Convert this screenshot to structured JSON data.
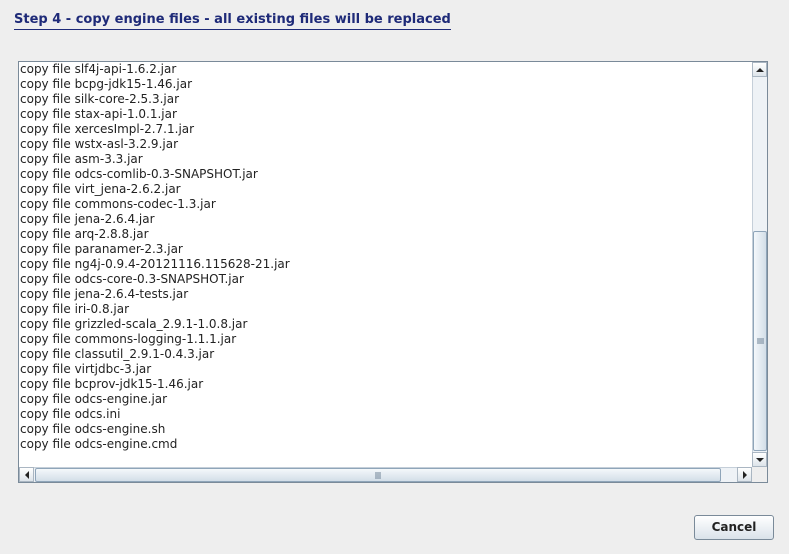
{
  "header": {
    "title": "Step 4 - copy engine files - all existing files will be replaced"
  },
  "log": {
    "lines": [
      "copy file slf4j-api-1.6.2.jar",
      "copy file bcpg-jdk15-1.46.jar",
      "copy file silk-core-2.5.3.jar",
      "copy file stax-api-1.0.1.jar",
      "copy file xercesImpl-2.7.1.jar",
      "copy file wstx-asl-3.2.9.jar",
      "copy file asm-3.3.jar",
      "copy file odcs-comlib-0.3-SNAPSHOT.jar",
      "copy file virt_jena-2.6.2.jar",
      "copy file commons-codec-1.3.jar",
      "copy file jena-2.6.4.jar",
      "copy file arq-2.8.8.jar",
      "copy file paranamer-2.3.jar",
      "copy file ng4j-0.9.4-20121116.115628-21.jar",
      "copy file odcs-core-0.3-SNAPSHOT.jar",
      "copy file jena-2.6.4-tests.jar",
      "copy file iri-0.8.jar",
      "copy file grizzled-scala_2.9.1-1.0.8.jar",
      "copy file commons-logging-1.1.1.jar",
      "copy file classutil_2.9.1-0.4.3.jar",
      "copy file virtjdbc-3.jar",
      "copy file bcprov-jdk15-1.46.jar",
      "copy file odcs-engine.jar",
      "copy file odcs.ini",
      "copy file odcs-engine.sh",
      "copy file odcs-engine.cmd"
    ]
  },
  "footer": {
    "cancel_label": "Cancel"
  },
  "icons": {
    "scroll_up": "arrow-up-icon",
    "scroll_down": "arrow-down-icon",
    "scroll_left": "arrow-left-icon",
    "scroll_right": "arrow-right-icon"
  },
  "colors": {
    "title": "#1e2a78",
    "background": "#eeeeee"
  }
}
